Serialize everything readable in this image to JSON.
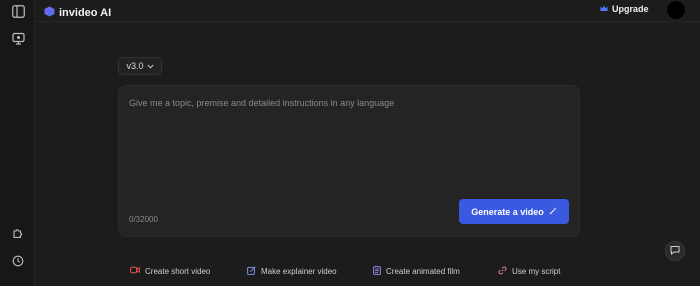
{
  "sidebar": {
    "items": [
      {
        "icon": "sidebar-toggle-icon"
      },
      {
        "icon": "monitor-icon"
      },
      {
        "icon": "puzzle-icon"
      },
      {
        "icon": "history-icon"
      }
    ]
  },
  "header": {
    "app_name": "invideo AI",
    "upgrade_label": "Upgrade"
  },
  "version": {
    "label": "v3.0"
  },
  "prompt": {
    "placeholder": "Give me a topic, premise and detailed instructions in any language",
    "value": "",
    "counter": "0/32000"
  },
  "generate": {
    "label": "Generate a video"
  },
  "chips": [
    {
      "label": "Create short video",
      "icon": "video-camera-icon",
      "color": "#e0584f"
    },
    {
      "label": "Make explainer video",
      "icon": "edit-icon",
      "color": "#7f8de6"
    },
    {
      "label": "Create animated film",
      "icon": "document-icon",
      "color": "#9b82e8"
    },
    {
      "label": "Use my script",
      "icon": "link-icon",
      "color": "#e07a9a"
    }
  ],
  "colors": {
    "accent": "#3b59e0",
    "background": "#1c1c1c"
  }
}
